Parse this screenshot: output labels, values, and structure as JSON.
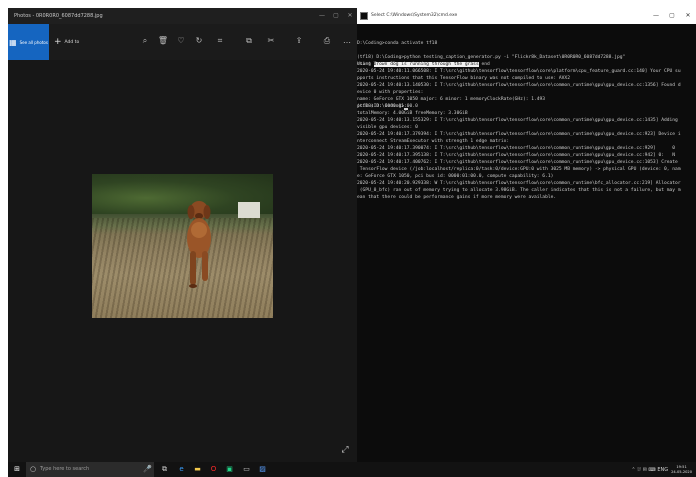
{
  "photos": {
    "title": "Photos - 0R0R0R0_6087dd7288.jpg",
    "toolbar": {
      "all_photos_label": "See all photos",
      "add_to_label": "Add to",
      "tools": [
        {
          "name": "zoom-icon",
          "glyph": "⌕"
        },
        {
          "name": "delete-icon",
          "glyph": "🗑"
        },
        {
          "name": "favorite-icon",
          "glyph": "♡"
        },
        {
          "name": "rotate-icon",
          "glyph": "↻"
        },
        {
          "name": "crop-icon",
          "glyph": "⌗"
        },
        {
          "name": "slideshow-icon",
          "glyph": "⧉"
        },
        {
          "name": "edit-create-icon",
          "glyph": "✂"
        },
        {
          "name": "share-icon",
          "glyph": "⇪"
        },
        {
          "name": "print-icon",
          "glyph": "⎙"
        },
        {
          "name": "more-icon",
          "glyph": "…"
        }
      ]
    },
    "window_controls": {
      "minimize": "—",
      "maximize": "▢",
      "close": "✕"
    },
    "expand_glyph": "⤢"
  },
  "cmd": {
    "title": "Select C:\\Windows\\System32\\cmd.exe",
    "window_controls": {
      "minimize": "—",
      "maximize": "▢",
      "close": "✕"
    },
    "lines": [
      "D:\\Coding>conda activate tf18",
      "",
      "(tf18) D:\\Coding>python testing_caption_generator.py -i \"Flickr8k_Dataset\\0R0R0R0_6087dd7288.jpg\"",
      "Using TensorFlow backend.",
      "2020-05-24 19:40:11.066508: I T:\\src\\github\\tensorflow\\tensorflow\\core\\platform\\cpu_feature_guard.cc:140] Your CPU su",
      "pports instructions that this TensorFlow binary was not compiled to use: AVX2",
      "2020-05-24 19:40:13.140530: I T:\\src\\github\\tensorflow\\tensorflow\\core\\common_runtime\\gpu\\gpu_device.cc:1356] Found d",
      "evice 0 with properties:",
      "name: GeForce GTX 1050 major: 6 minor: 1 memoryClockRate(GHz): 1.493",
      "pciBusID: 0000:01:00.0",
      "totalMemory: 4.00GiB freeMemory: 3.30GiB",
      "2020-05-24 19:40:13.155329: I T:\\src\\github\\tensorflow\\tensorflow\\core\\common_runtime\\gpu\\gpu_device.cc:1435] Adding",
      "visible gpu devices: 0",
      "2020-05-24 19:40:17.379394: I T:\\src\\github\\tensorflow\\tensorflow\\core\\common_runtime\\gpu\\gpu_device.cc:923] Device i",
      "nterconnect StreamExecutor with strength 1 edge matrix:",
      "2020-05-24 19:40:17.390074: I T:\\src\\github\\tensorflow\\tensorflow\\core\\common_runtime\\gpu\\gpu_device.cc:929]      0",
      "2020-05-24 19:40:17.395138: I T:\\src\\github\\tensorflow\\tensorflow\\core\\common_runtime\\gpu\\gpu_device.cc:942] 0:   N",
      "2020-05-24 19:40:17.400762: I T:\\src\\github\\tensorflow\\tensorflow\\core\\common_runtime\\gpu\\gpu_device.cc:1053] Create",
      " TensorFlow device (/job:localhost/replica:0/task:0/device:GPU:0 with 3025 MB memory) -> physical GPU (device: 0, nam",
      "e: GeForce GTX 1050, pci bus id: 0000:01:00.0, compute capability: 6.1)",
      "2020-05-24 19:40:20.929338: W T:\\src\\github\\tensorflow\\tensorflow\\core\\common_runtime\\bfc_allocator.cc:219] Allocator",
      " (GPU_0_bfc) ran out of memory trying to allocate 3.98GiB. The caller indicates that this is not a failure, but may m",
      "ean that there could be performance gains if more memory were available.",
      "",
      "",
      "",
      "",
      "",
      "",
      ""
    ],
    "result": {
      "prefix": "start ",
      "highlight": "brown dog is running through the grass",
      "suffix": " end"
    },
    "prompt_line": "(tf18) D:\\Coding>"
  },
  "taskbar": {
    "start_glyph": "⊞",
    "search_placeholder": "Type here to search",
    "search_glyph": "○",
    "pinned": [
      {
        "name": "microphone-icon",
        "glyph": "🎤",
        "color": "#bdbdbd"
      },
      {
        "name": "task-view-icon",
        "glyph": "⧉",
        "color": "#d0d0d0"
      },
      {
        "name": "edge-icon",
        "glyph": "e",
        "color": "#3aa0ff"
      },
      {
        "name": "file-explorer-icon",
        "glyph": "▬",
        "color": "#f2c94c"
      },
      {
        "name": "opera-icon",
        "glyph": "O",
        "color": "#ff2b2b"
      },
      {
        "name": "pycharm-icon",
        "glyph": "▣",
        "color": "#21d789"
      },
      {
        "name": "cmd-icon",
        "glyph": "▭",
        "color": "#cfcfcf"
      },
      {
        "name": "photos-icon",
        "glyph": "▨",
        "color": "#5aa0ff"
      }
    ],
    "tray_glyphs": "⌃  ⛆ ✉ ⌨ ENG",
    "clock_time": "19:51",
    "clock_date": "24-05-2020"
  }
}
